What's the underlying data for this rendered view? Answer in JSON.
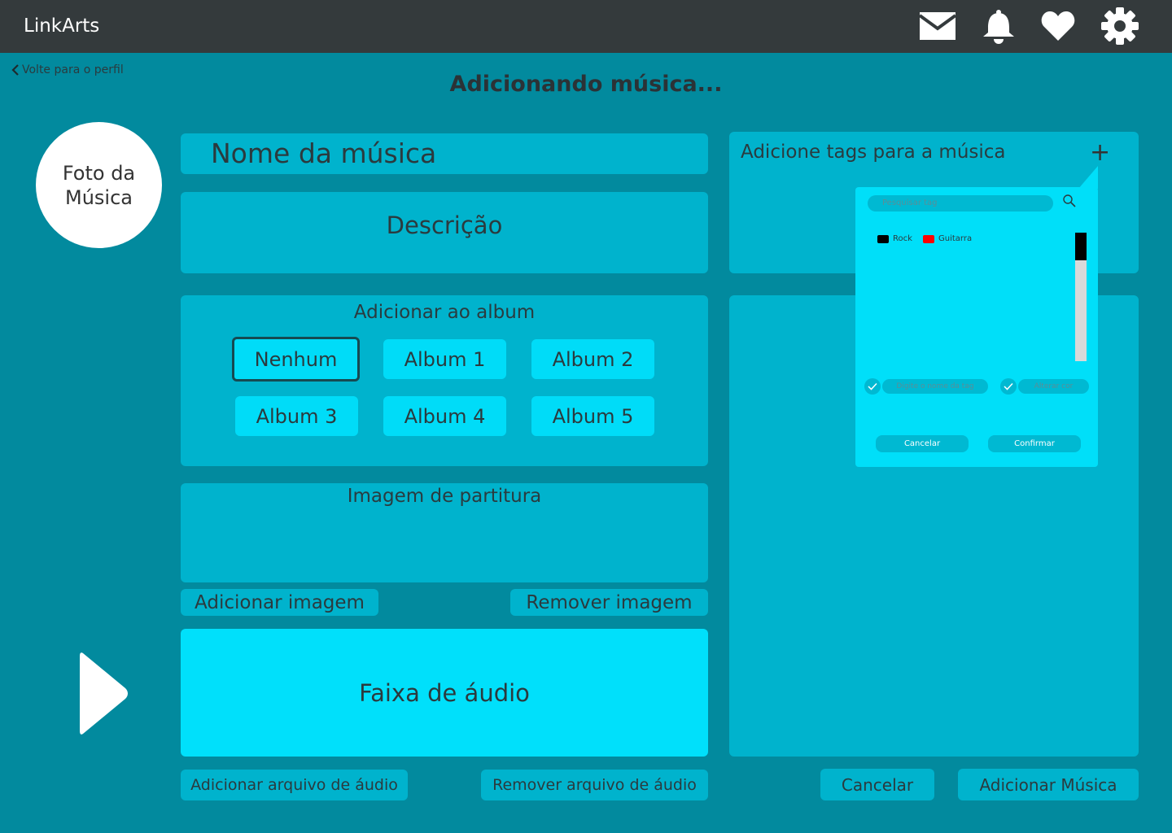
{
  "app": {
    "title": "LinkArts"
  },
  "topbar": {
    "icons": [
      "mail-icon",
      "bell-icon",
      "heart-icon",
      "gear-icon"
    ]
  },
  "nav": {
    "back_label": "Volte para o perfil"
  },
  "page": {
    "title": "Adicionando música..."
  },
  "photo": {
    "label": "Foto da\nMúsica"
  },
  "form": {
    "name_placeholder": "Nome da música",
    "description_placeholder": "Descrição"
  },
  "album": {
    "title": "Adicionar ao album",
    "options": [
      "Nenhum",
      "Album 1",
      "Album 2",
      "Album 3",
      "Album 4",
      "Album 5"
    ],
    "selected": "Nenhum"
  },
  "sheet": {
    "title": "Imagem de partitura",
    "add_label": "Adicionar imagem",
    "remove_label": "Remover imagem"
  },
  "audio": {
    "title": "Faixa de áudio",
    "add_label": "Adicionar arquivo de áudio",
    "remove_label": "Remover arquivo de áudio"
  },
  "tags": {
    "title": "Adicione tags para a música",
    "add_symbol": "+",
    "popup": {
      "search_placeholder": "Pesquisar tag",
      "items": [
        {
          "label": "Rock",
          "color": "#000000"
        },
        {
          "label": "Guitarra",
          "color": "#FF0000"
        }
      ],
      "name_placeholder": "Digite o nome da tag",
      "color_placeholder": "Alterar cor",
      "cancel_label": "Cancelar",
      "confirm_label": "Confirmar"
    }
  },
  "actions": {
    "cancel_label": "Cancelar",
    "submit_label": "Adicionar Música"
  },
  "colors": {
    "background": "#028A9E",
    "topbar": "#343A3C",
    "panel": "#00B3CD",
    "highlight": "#00E0FB"
  }
}
